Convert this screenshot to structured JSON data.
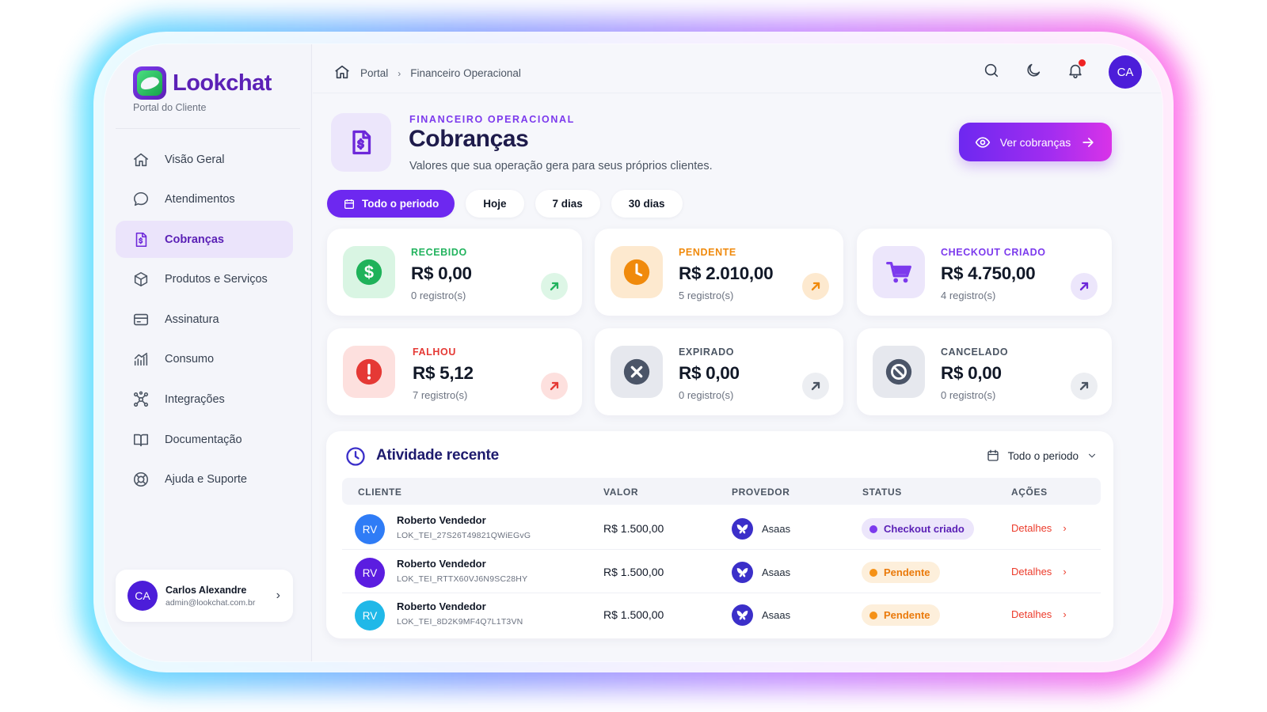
{
  "brand": {
    "name": "Lookchat",
    "subtitle": "Portal do Cliente"
  },
  "sidebar": {
    "items": [
      {
        "label": "Visão Geral",
        "icon": "home-icon"
      },
      {
        "label": "Atendimentos",
        "icon": "chat-icon"
      },
      {
        "label": "Cobranças",
        "icon": "invoice-icon",
        "active": true
      },
      {
        "label": "Produtos e Serviços",
        "icon": "box-icon"
      },
      {
        "label": "Assinatura",
        "icon": "card-icon"
      },
      {
        "label": "Consumo",
        "icon": "chart-icon"
      },
      {
        "label": "Integrações",
        "icon": "network-icon"
      },
      {
        "label": "Documentação",
        "icon": "book-icon"
      },
      {
        "label": "Ajuda e Suporte",
        "icon": "lifebuoy-icon"
      }
    ],
    "user": {
      "initials": "CA",
      "name": "Carlos Alexandre",
      "email": "admin@lookchat.com.br"
    }
  },
  "topbar": {
    "breadcrumb": [
      "Portal",
      "Financeiro Operacional"
    ],
    "avatar": "CA"
  },
  "header": {
    "eyebrow": "FINANCEIRO OPERACIONAL",
    "title": "Cobranças",
    "subtitle": "Valores que sua operação gera para seus próprios clientes.",
    "cta": "Ver cobranças"
  },
  "filters": [
    "Todo o periodo",
    "Hoje",
    "7 dias",
    "30 dias"
  ],
  "cards": [
    {
      "label": "RECEBIDO",
      "value": "R$ 0,00",
      "count": "0 registro(s)",
      "color": "#22b35e"
    },
    {
      "label": "PENDENTE",
      "value": "R$ 2.010,00",
      "count": "5 registro(s)",
      "color": "#f08a0c"
    },
    {
      "label": "CHECKOUT CRIADO",
      "value": "R$ 4.750,00",
      "count": "4 registro(s)",
      "color": "#7c3aed"
    },
    {
      "label": "FALHOU",
      "value": "R$ 5,12",
      "count": "7 registro(s)",
      "color": "#e53935"
    },
    {
      "label": "EXPIRADO",
      "value": "R$ 0,00",
      "count": "0 registro(s)",
      "color": "#4b5563"
    },
    {
      "label": "CANCELADO",
      "value": "R$ 0,00",
      "count": "0 registro(s)",
      "color": "#4b5563"
    }
  ],
  "activity": {
    "title": "Atividade recente",
    "period": "Todo o periodo",
    "columns": [
      "CLIENTE",
      "VALOR",
      "PROVEDOR",
      "STATUS",
      "AÇÕES"
    ],
    "rows": [
      {
        "initials": "RV",
        "avatar_color": "#2f7cf6",
        "client": "Roberto Vendedor",
        "id": "LOK_TEI_27S26T49821QWiEGvG",
        "amount": "R$ 1.500,00",
        "provider": "Asaas",
        "status": "Checkout criado",
        "action": "Detalhes"
      },
      {
        "initials": "RV",
        "avatar_color": "#5b1de0",
        "client": "Roberto Vendedor",
        "id": "LOK_TEI_RTTX60VJ6N9SC28HY",
        "amount": "R$ 1.500,00",
        "provider": "Asaas",
        "status": "Pendente",
        "action": "Detalhes"
      },
      {
        "initials": "RV",
        "avatar_color": "#20b8e8",
        "client": "Roberto Vendedor",
        "id": "LOK_TEI_8D2K9MF4Q7L1T3VN",
        "amount": "R$ 1.500,00",
        "provider": "Asaas",
        "status": "Pendente",
        "action": "Detalhes"
      }
    ]
  }
}
